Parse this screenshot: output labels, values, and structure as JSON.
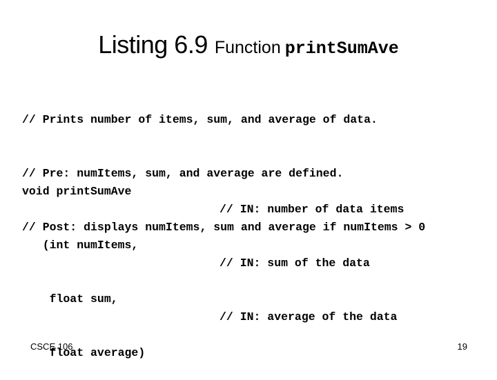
{
  "slide": {
    "title": {
      "listing": "Listing 6.9",
      "label": "Function",
      "function_name": "printSumAve"
    },
    "header_comments": [
      "// Prints number of items, sum, and average of data.",
      "// Pre: numItems, sum, and average are defined.",
      "// Post: displays numItems, sum and average if numItems > 0"
    ],
    "signature": [
      "void printSumAve",
      "   (int numItems,",
      "    float sum,",
      "    float average)"
    ],
    "param_comments": [
      "// IN: number of data items",
      "// IN: sum of the data",
      "// IN: average of the data"
    ],
    "footer": {
      "course": "CSCE 106",
      "page_number": "19"
    }
  }
}
